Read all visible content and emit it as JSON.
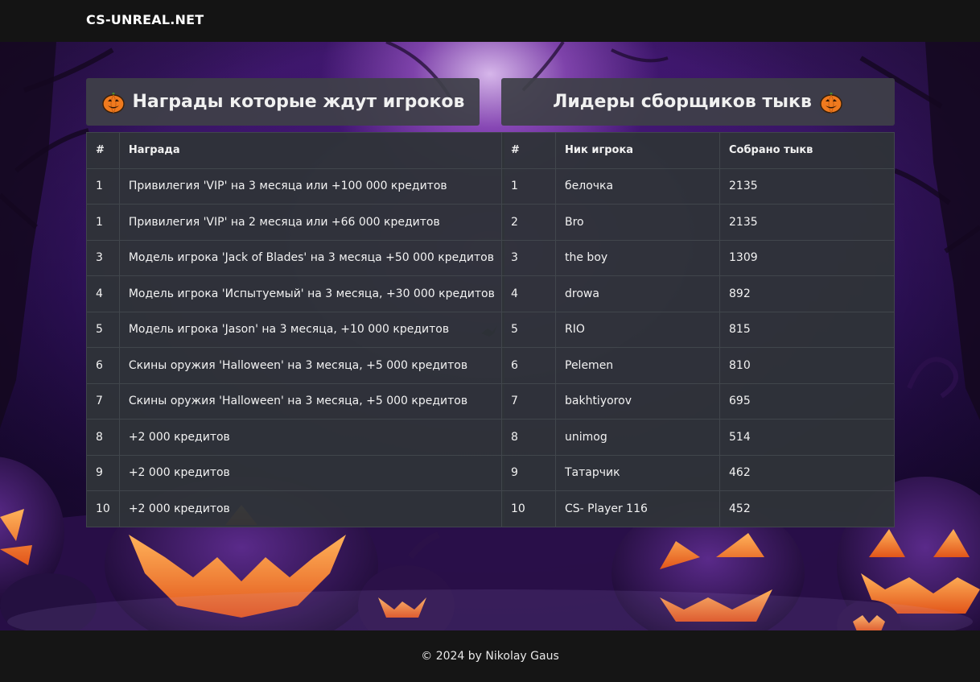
{
  "header": {
    "brand": "CS-UNREAL.NET"
  },
  "rewards": {
    "title": "Награды которые ждут игроков",
    "title_icon": "pumpkin-icon",
    "columns": [
      "#",
      "Награда"
    ],
    "rows": [
      {
        "num": "1",
        "reward": "Привилегия 'VIP' на 3 месяца или +100 000 кредитов"
      },
      {
        "num": "1",
        "reward": "Привилегия 'VIP' на 2 месяца или +66 000 кредитов"
      },
      {
        "num": "3",
        "reward": "Модель игрока 'Jack of Blades' на 3 месяца +50 000 кредитов"
      },
      {
        "num": "4",
        "reward": "Модель игрока 'Испытуемый' на 3 месяца, +30 000 кредитов"
      },
      {
        "num": "5",
        "reward": "Модель игрока 'Jason' на 3 месяца, +10 000 кредитов"
      },
      {
        "num": "6",
        "reward": "Скины оружия 'Halloween' на 3 месяца, +5 000 кредитов"
      },
      {
        "num": "7",
        "reward": "Скины оружия 'Halloween' на 3 месяца, +5 000 кредитов"
      },
      {
        "num": "8",
        "reward": "+2 000 кредитов"
      },
      {
        "num": "9",
        "reward": "+2 000 кредитов"
      },
      {
        "num": "10",
        "reward": "+2 000 кредитов"
      }
    ]
  },
  "leaders": {
    "title": "Лидеры сборщиков тыкв",
    "title_icon": "pumpkin-icon",
    "columns": [
      "#",
      "Ник игрока",
      "Собрано тыкв"
    ],
    "rows": [
      {
        "num": "1",
        "nick": "белочка",
        "count": "2135"
      },
      {
        "num": "2",
        "nick": "Bro",
        "count": "2135"
      },
      {
        "num": "3",
        "nick": "the boy",
        "count": "1309"
      },
      {
        "num": "4",
        "nick": "drowa",
        "count": "892"
      },
      {
        "num": "5",
        "nick": "RIO",
        "count": "815"
      },
      {
        "num": "6",
        "nick": "Pelemen",
        "count": "810"
      },
      {
        "num": "7",
        "nick": "bakhtiyorov",
        "count": "695"
      },
      {
        "num": "8",
        "nick": "unimog",
        "count": "514"
      },
      {
        "num": "9",
        "nick": "Татарчик",
        "count": "462"
      },
      {
        "num": "10",
        "nick": "CS- Player 116",
        "count": "452"
      }
    ]
  },
  "footer": {
    "text": "© 2024 by Nikolay Gaus"
  },
  "colors": {
    "topbar": "#141414",
    "panel": "#2f3338",
    "title_panel": "#3e4048",
    "accent_purple": "#6a2aa8",
    "pumpkin_orange": "#f07a1e"
  }
}
